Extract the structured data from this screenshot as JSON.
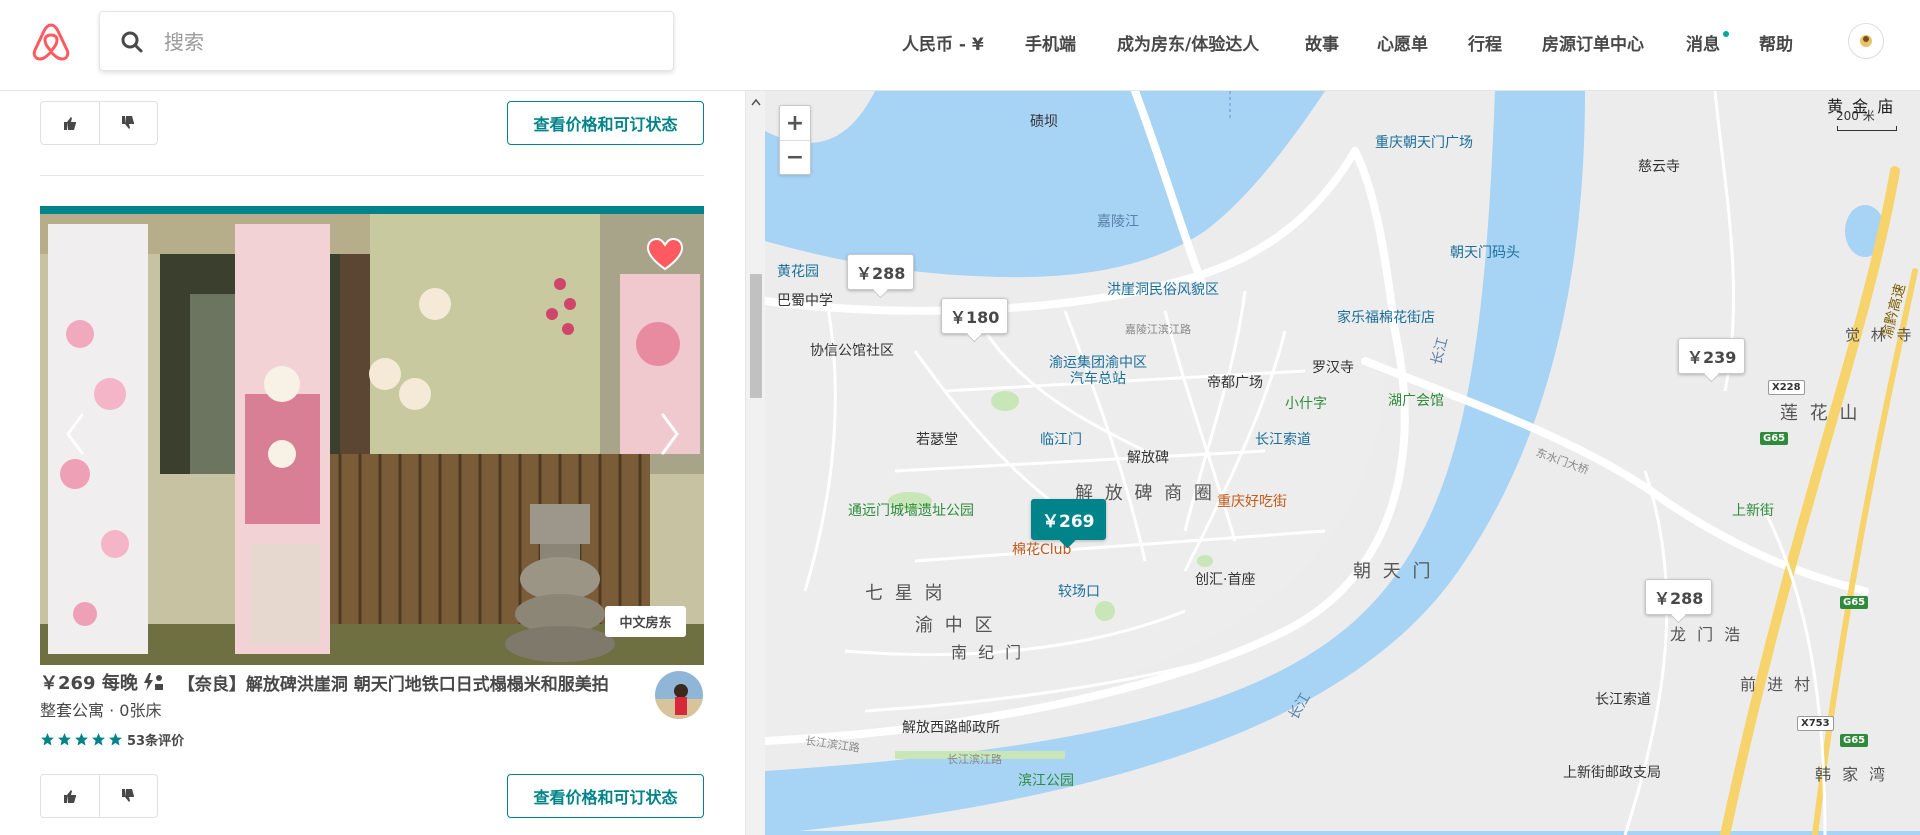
{
  "header": {
    "search": {
      "placeholder": "搜索"
    },
    "nav": {
      "currency": "人民币 - ¥",
      "mobile": "手机端",
      "become_host": "成为房东/体验达人",
      "stories": "故事",
      "wishlist": "心愿单",
      "trips": "行程",
      "reservations": "房源订单中心",
      "messages": "消息",
      "help": "帮助"
    },
    "icons": {
      "logo": "airbnb-logo",
      "search": "search-icon",
      "avatar": "user-avatar"
    },
    "colors": {
      "brand": "#ff5a5f",
      "accent": "#00848a",
      "unread_dot": "#00a699"
    }
  },
  "listings": {
    "check_button_label": "查看价格和可订状态",
    "card": {
      "price": "￥269 每晚",
      "title": "【奈良】解放碑洪崖洞 朝天门地铁口日式榻榻米和服美拍",
      "subtitle": "整套公寓 · 0张床",
      "rating": 5,
      "reviews": "53条评价",
      "host_badge": "中文房东",
      "instant_book": true,
      "favorited": true
    }
  },
  "map": {
    "zoom_in": "+",
    "zoom_out": "−",
    "scale": "200 米",
    "price_pins": [
      {
        "label": "￥288",
        "active": false
      },
      {
        "label": "￥180",
        "active": false
      },
      {
        "label": "￥269",
        "active": true
      },
      {
        "label": "￥239",
        "active": false
      },
      {
        "label": "￥288",
        "active": false
      }
    ],
    "labels": {
      "jialing_river": "嘉陵江",
      "changjiang_1": "长江",
      "changjiang_2": "长江",
      "yuzhong": "渝 中 区",
      "jiefangbei_circle": "解 放 碑 商 圈",
      "chaotianmen": "朝 天 门",
      "qixinggang": "七 星 岗",
      "nanjimen": "南 纪 门",
      "lianhuashan": "莲 花 山",
      "longmenhao": "龙 门 浩",
      "qianjincun": "前 进 村",
      "hanjiawan": "韩 家 湾",
      "huangjinpo": "黄 金 庙",
      "juelinsi": "觉 林 寺",
      "qiba": "碛坝",
      "chongqing_chaotianmen_square": "重庆朝天门广场",
      "chaotianmen_wharf": "朝天门码头",
      "ciyunsi": "慈云寺",
      "hongyadong": "洪崖洞民俗风貌区",
      "jialefu": "家乐福棉花街店",
      "huanghuayuan": "黄花园",
      "bashu_school": "巴蜀中学",
      "xiexin": "协信公馆社区",
      "yuyun": "渝运集团渝中区汽车总站",
      "didu": "帝都广场",
      "luohansi": "罗汉寺",
      "xiaoshizi": "小什字",
      "huguang": "湖广会馆",
      "ruohuitang": "若瑟堂",
      "linjiangmen": "临江门",
      "jiefangbei": "解放碑",
      "changjiang_cableway": "长江索道",
      "changjiang_cableway_2": "长江索道",
      "tongyuanmen": "通远门城墙遗址公园",
      "chongqing_haochijie": "重庆好吃街",
      "mianhua_club": "棉花Club",
      "jiaochangkou": "较场口",
      "chuanghui": "创汇·首座",
      "jiefang_west_post": "解放西路邮政所",
      "binjiang_park": "滨江公园",
      "shangxinjie": "上新街",
      "shangxinjie_post": "上新街邮政支局",
      "yuqian_highway": "渝黔高速",
      "jialing_binjiang_rd": "嘉陵江滨江路",
      "changjiang_binjiang_rd": "长江滨江路",
      "changjiang_binjiang_rd_2": "长江滨江路",
      "dongshuimen_bridge": "东水门大桥",
      "x228": "X228",
      "g65_1": "G65",
      "g65_2": "G65",
      "g65_3": "G65",
      "x753": "X753"
    },
    "colors": {
      "water": "#a7d3f5",
      "land": "#ececec",
      "road": "#ffffff",
      "park": "#c8e6b8"
    }
  }
}
